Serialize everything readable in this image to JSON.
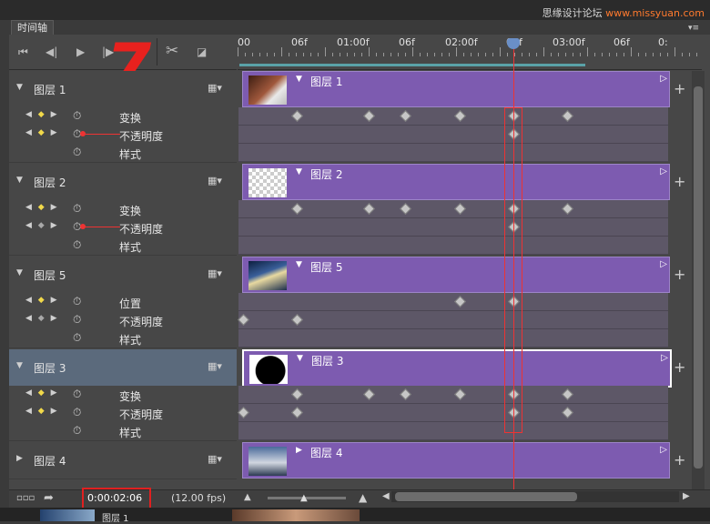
{
  "watermark": {
    "part1": "思缘设计论坛",
    "part2": "www.missyuan.com"
  },
  "panel": {
    "tab_title": "时间轴"
  },
  "controls": {
    "first": "⏮",
    "prev": "◀|",
    "play": "▶",
    "next": "|▶",
    "cut": "✂",
    "transition": "◪"
  },
  "annotation": {
    "number": "7"
  },
  "ruler": {
    "labels": [
      "00",
      "06f",
      "01:00f",
      "06f",
      "02:00f",
      "06f",
      "03:00f",
      "06f",
      "0:"
    ]
  },
  "icons": {
    "film": "film-strip-icon",
    "stopwatch": "stopwatch-icon",
    "add": "plus-icon"
  },
  "layers": [
    {
      "name": "图层 1",
      "clip_name": "图层 1",
      "thumb": "hand",
      "expanded": true,
      "props": [
        {
          "name": "变换"
        },
        {
          "name": "不透明度"
        },
        {
          "name": "样式"
        }
      ]
    },
    {
      "name": "图层 2",
      "clip_name": "图层 2",
      "thumb": "transparent",
      "expanded": true,
      "props": [
        {
          "name": "变换"
        },
        {
          "name": "不透明度"
        },
        {
          "name": "样式"
        }
      ]
    },
    {
      "name": "图层 5",
      "clip_name": "图层 5",
      "thumb": "city",
      "expanded": true,
      "props": [
        {
          "name": "位置"
        },
        {
          "name": "不透明度"
        },
        {
          "name": "样式"
        }
      ]
    },
    {
      "name": "图层 3",
      "clip_name": "图层 3",
      "thumb": "black-shape",
      "expanded": true,
      "selected": true,
      "props": [
        {
          "name": "变换"
        },
        {
          "name": "不透明度"
        },
        {
          "name": "样式"
        }
      ]
    },
    {
      "name": "图层 4",
      "clip_name": "图层 4",
      "thumb": "sky",
      "expanded": false,
      "props": []
    }
  ],
  "status": {
    "timecode": "0:00:02:06",
    "fps": "(12.00 fps)"
  },
  "footer": {
    "label": "图层 1"
  },
  "colors": {
    "clip": "#7d5bb0",
    "playhead": "#e33333",
    "highlight_box": "#e02020",
    "keyframe_active": "#f1d94a"
  }
}
